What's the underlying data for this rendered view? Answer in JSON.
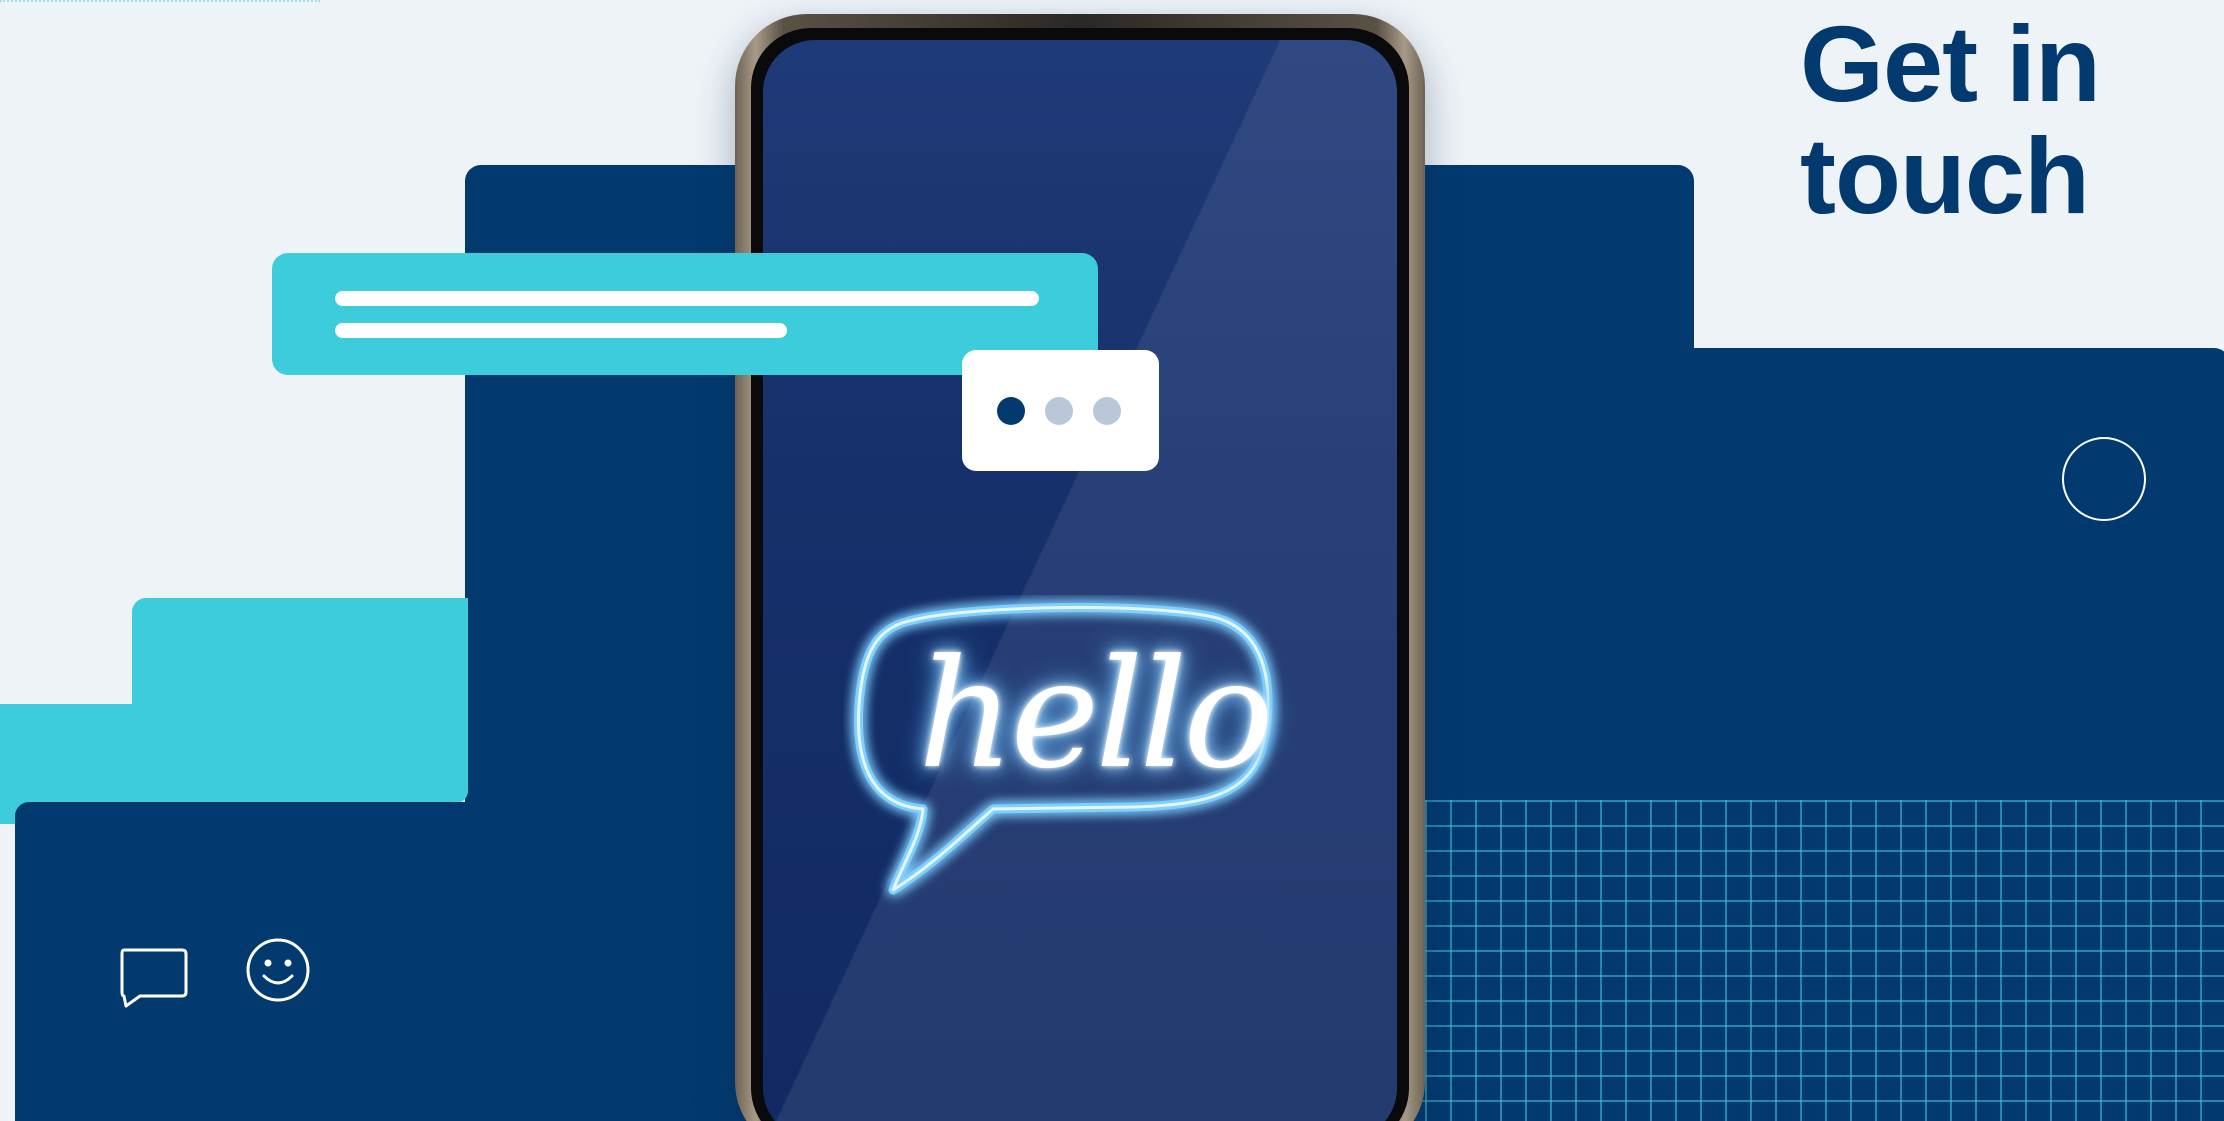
{
  "hero": {
    "title_line1": "Get in",
    "title_line2": "touch"
  },
  "phone": {
    "neon_text": "hello"
  },
  "colors": {
    "navy": "#023a70",
    "cyan": "#3cccdb",
    "background": "#eef3f8",
    "dot_active": "#023a70",
    "dot_inactive": "#b9c8d8"
  },
  "typing_indicator": {
    "dots": [
      "active",
      "inactive",
      "inactive"
    ]
  },
  "icons": {
    "chat": "chat-bubble-icon",
    "smile": "smiley-face-icon",
    "ring": "circle-outline-icon"
  }
}
